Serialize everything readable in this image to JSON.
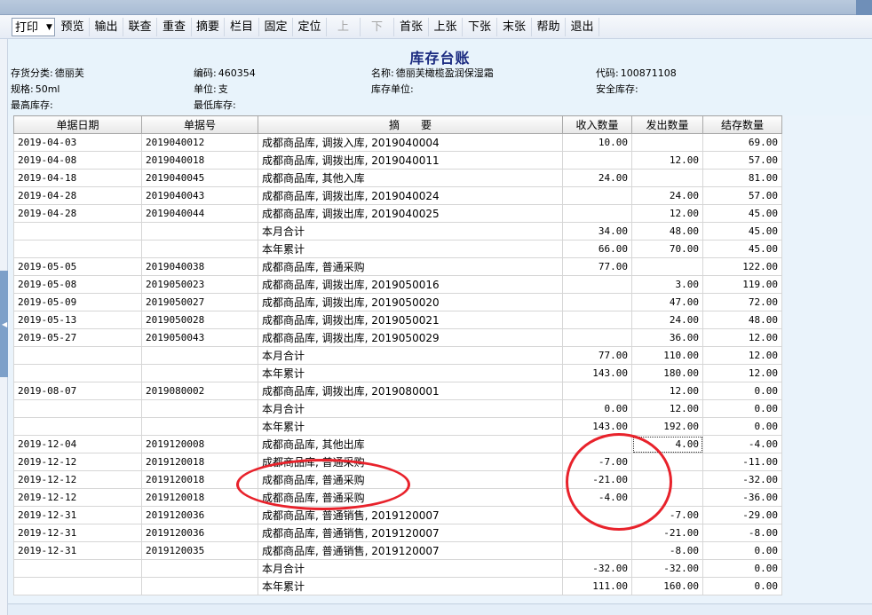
{
  "toolbar": {
    "items": [
      {
        "label": "打印",
        "disabled": false
      },
      {
        "label": "预览",
        "disabled": false
      },
      {
        "label": "输出",
        "disabled": false
      },
      {
        "label": "联查",
        "disabled": false
      },
      {
        "label": "重查",
        "disabled": false
      },
      {
        "label": "摘要",
        "disabled": false
      },
      {
        "label": "栏目",
        "disabled": false
      },
      {
        "label": "固定",
        "disabled": false
      },
      {
        "label": "定位",
        "disabled": false
      },
      {
        "label": "上",
        "disabled": true
      },
      {
        "label": "下",
        "disabled": true
      },
      {
        "label": "首张",
        "disabled": false
      },
      {
        "label": "上张",
        "disabled": false
      },
      {
        "label": "下张",
        "disabled": false
      },
      {
        "label": "末张",
        "disabled": false
      },
      {
        "label": "帮助",
        "disabled": false
      },
      {
        "label": "退出",
        "disabled": false
      }
    ],
    "print_arrow": "▼"
  },
  "report": {
    "title": "库存台账",
    "fields": {
      "category": {
        "label": "存货分类:",
        "value": "德丽芙"
      },
      "code": {
        "label": "编码:",
        "value": "460354"
      },
      "name": {
        "label": "名称:",
        "value": "德丽芙橄榄盈润保湿霜"
      },
      "dcode": {
        "label": "代码:",
        "value": "100871108"
      },
      "spec": {
        "label": "规格:",
        "value": "50ml"
      },
      "unit": {
        "label": "单位:",
        "value": "支"
      },
      "stock_unit": {
        "label": "库存单位:",
        "value": ""
      },
      "safety": {
        "label": "安全库存:",
        "value": ""
      },
      "max_stock": {
        "label": "最高库存:",
        "value": ""
      },
      "min_stock": {
        "label": "最低库存:",
        "value": ""
      }
    }
  },
  "table": {
    "columns": [
      "单据日期",
      "单据号",
      "摘　　要",
      "收入数量",
      "发出数量",
      "结存数量"
    ],
    "rows": [
      {
        "date": "2019-04-03",
        "doc": "2019040012",
        "summary": "成都商品库, 调拨入库, 2019040004",
        "in": "10.00",
        "out": "",
        "bal": "69.00"
      },
      {
        "date": "2019-04-08",
        "doc": "2019040018",
        "summary": "成都商品库, 调拨出库, 2019040011",
        "in": "",
        "out": "12.00",
        "bal": "57.00"
      },
      {
        "date": "2019-04-18",
        "doc": "2019040045",
        "summary": "成都商品库, 其他入库",
        "in": "24.00",
        "out": "",
        "bal": "81.00"
      },
      {
        "date": "2019-04-28",
        "doc": "2019040043",
        "summary": "成都商品库, 调拨出库, 2019040024",
        "in": "",
        "out": "24.00",
        "bal": "57.00"
      },
      {
        "date": "2019-04-28",
        "doc": "2019040044",
        "summary": "成都商品库, 调拨出库, 2019040025",
        "in": "",
        "out": "12.00",
        "bal": "45.00"
      },
      {
        "date": "",
        "doc": "",
        "summary": "本月合计",
        "in": "34.00",
        "out": "48.00",
        "bal": "45.00"
      },
      {
        "date": "",
        "doc": "",
        "summary": "本年累计",
        "in": "66.00",
        "out": "70.00",
        "bal": "45.00"
      },
      {
        "date": "2019-05-05",
        "doc": "2019040038",
        "summary": "成都商品库, 普通采购",
        "in": "77.00",
        "out": "",
        "bal": "122.00"
      },
      {
        "date": "2019-05-08",
        "doc": "2019050023",
        "summary": "成都商品库, 调拨出库, 2019050016",
        "in": "",
        "out": "3.00",
        "bal": "119.00"
      },
      {
        "date": "2019-05-09",
        "doc": "2019050027",
        "summary": "成都商品库, 调拨出库, 2019050020",
        "in": "",
        "out": "47.00",
        "bal": "72.00"
      },
      {
        "date": "2019-05-13",
        "doc": "2019050028",
        "summary": "成都商品库, 调拨出库, 2019050021",
        "in": "",
        "out": "24.00",
        "bal": "48.00"
      },
      {
        "date": "2019-05-27",
        "doc": "2019050043",
        "summary": "成都商品库, 调拨出库, 2019050029",
        "in": "",
        "out": "36.00",
        "bal": "12.00"
      },
      {
        "date": "",
        "doc": "",
        "summary": "本月合计",
        "in": "77.00",
        "out": "110.00",
        "bal": "12.00"
      },
      {
        "date": "",
        "doc": "",
        "summary": "本年累计",
        "in": "143.00",
        "out": "180.00",
        "bal": "12.00"
      },
      {
        "date": "2019-08-07",
        "doc": "2019080002",
        "summary": "成都商品库, 调拨出库, 2019080001",
        "in": "",
        "out": "12.00",
        "bal": "0.00"
      },
      {
        "date": "",
        "doc": "",
        "summary": "本月合计",
        "in": "0.00",
        "out": "12.00",
        "bal": "0.00"
      },
      {
        "date": "",
        "doc": "",
        "summary": "本年累计",
        "in": "143.00",
        "out": "192.00",
        "bal": "0.00"
      },
      {
        "date": "2019-12-04",
        "doc": "2019120008",
        "summary": "成都商品库, 其他出库",
        "in": "",
        "out": "4.00",
        "bal": "-4.00",
        "focus": true
      },
      {
        "date": "2019-12-12",
        "doc": "2019120018",
        "summary": "成都商品库, 普通采购",
        "in": "-7.00",
        "out": "",
        "bal": "-11.00"
      },
      {
        "date": "2019-12-12",
        "doc": "2019120018",
        "summary": "成都商品库, 普通采购",
        "in": "-21.00",
        "out": "",
        "bal": "-32.00"
      },
      {
        "date": "2019-12-12",
        "doc": "2019120018",
        "summary": "成都商品库, 普通采购",
        "in": "-4.00",
        "out": "",
        "bal": "-36.00"
      },
      {
        "date": "2019-12-31",
        "doc": "2019120036",
        "summary": "成都商品库, 普通销售, 2019120007",
        "in": "",
        "out": "-7.00",
        "bal": "-29.00"
      },
      {
        "date": "2019-12-31",
        "doc": "2019120036",
        "summary": "成都商品库, 普通销售, 2019120007",
        "in": "",
        "out": "-21.00",
        "bal": "-8.00"
      },
      {
        "date": "2019-12-31",
        "doc": "2019120035",
        "summary": "成都商品库, 普通销售, 2019120007",
        "in": "",
        "out": "-8.00",
        "bal": "0.00"
      },
      {
        "date": "",
        "doc": "",
        "summary": "本月合计",
        "in": "-32.00",
        "out": "-32.00",
        "bal": "0.00"
      },
      {
        "date": "",
        "doc": "",
        "summary": "本年累计",
        "in": "111.00",
        "out": "160.00",
        "bal": "0.00"
      }
    ]
  },
  "annotations": {
    "color": "#e8222b"
  }
}
